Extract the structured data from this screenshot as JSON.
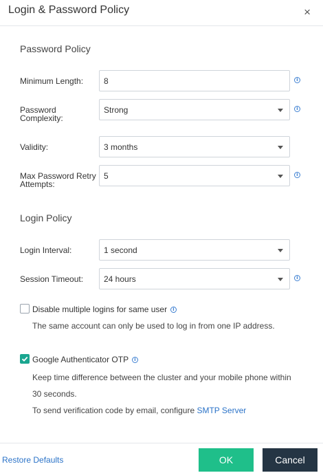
{
  "dialog": {
    "title": "Login & Password Policy",
    "close_glyph": "×"
  },
  "password_policy": {
    "heading": "Password Policy",
    "min_length": {
      "label": "Minimum Length:",
      "value": "8"
    },
    "complexity": {
      "label_line1": "Password",
      "label_line2": "Complexity:",
      "value": "Strong"
    },
    "validity": {
      "label": "Validity:",
      "value": "3 months"
    },
    "retry": {
      "label_line1": "Max Password Retry",
      "label_line2": "Attempts:",
      "value": "5"
    }
  },
  "login_policy": {
    "heading": "Login Policy",
    "interval": {
      "label": "Login Interval:",
      "value": "1 second"
    },
    "timeout": {
      "label": "Session Timeout:",
      "value": "24 hours"
    },
    "multi_login": {
      "label": "Disable multiple logins for same user",
      "checked": false,
      "desc": "The same account can only be used to log in from one IP address."
    },
    "otp": {
      "label": "Google Authenticator OTP",
      "checked": true,
      "desc_line1": "Keep time difference between the cluster and your mobile phone within",
      "desc_line2": "30 seconds.",
      "email_prefix": "To send verification code by email, configure ",
      "email_link": "SMTP Server"
    }
  },
  "footer": {
    "restore": "Restore Defaults",
    "ok": "OK",
    "cancel": "Cancel"
  },
  "icons": {
    "info": "info-circle-icon",
    "caret": "caret-down-icon",
    "check": "checkmark-icon",
    "close": "close-icon"
  },
  "colors": {
    "accent": "#1fbf8a",
    "check": "#1aa690",
    "link": "#2b73c8",
    "dark_button": "#253544"
  }
}
